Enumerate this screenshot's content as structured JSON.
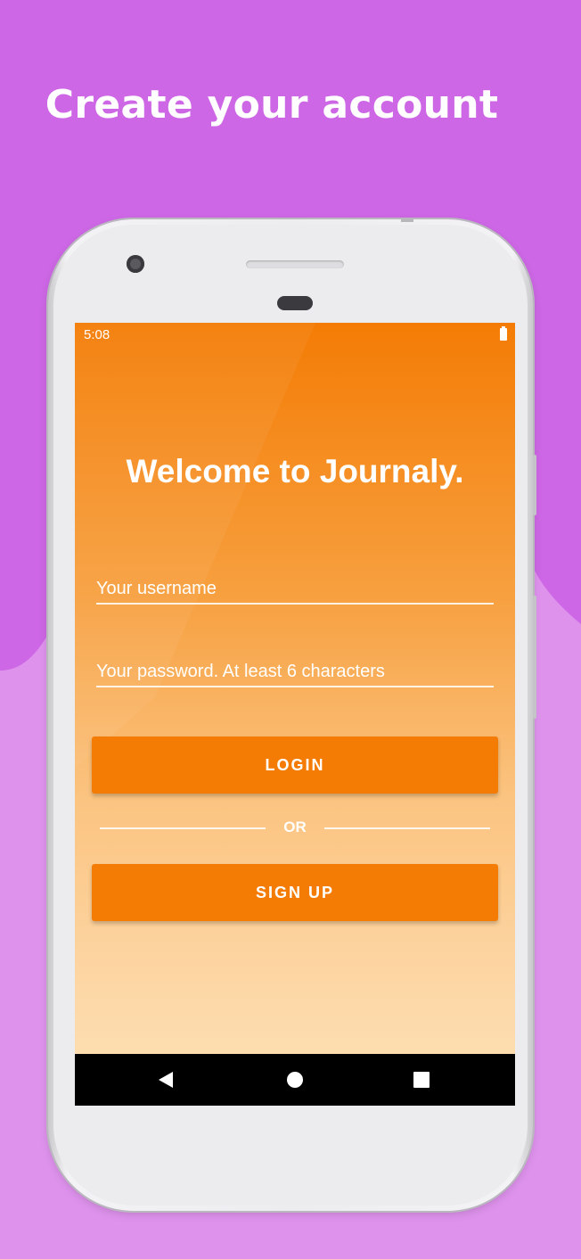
{
  "headline": "Create your account",
  "status_bar": {
    "time": "5:08"
  },
  "welcome_title": "Welcome to Journaly.",
  "form": {
    "username_placeholder": "Your username",
    "password_placeholder": "Your password. At least 6 characters",
    "login_label": "LOGIN",
    "divider_label": "OR",
    "signup_label": "SIGN UP"
  },
  "colors": {
    "background_top": "#cd67e5",
    "background_bottom": "#de92ec",
    "accent": "#f47c05"
  },
  "icons": {
    "battery": "battery-icon",
    "back": "back-icon",
    "home": "home-icon",
    "recents": "recents-icon"
  }
}
